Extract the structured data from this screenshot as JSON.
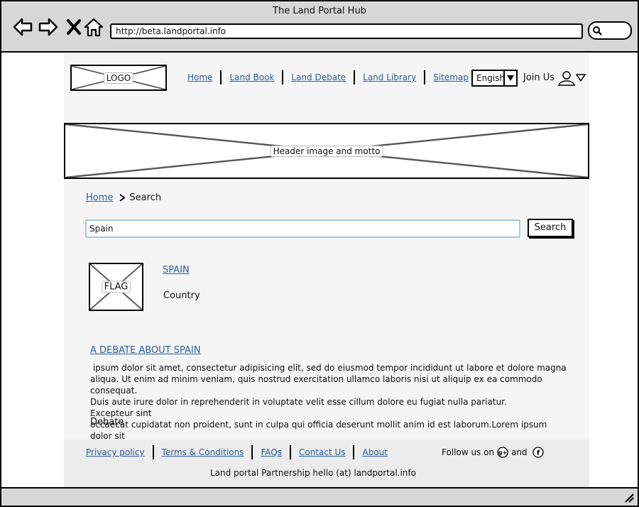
{
  "browser": {
    "title": "The Land Portal Hub",
    "url": "http://beta.landportal.info"
  },
  "header": {
    "logo_label": "LOGO",
    "menu": [
      "Home",
      "Land Book",
      "Land Debate",
      "Land Library",
      "Sitemap"
    ],
    "language": "Engish",
    "join_us": "Join Us"
  },
  "banner": {
    "label": "Header image and motto"
  },
  "breadcrumb": {
    "home": "Home",
    "current": "Search"
  },
  "search": {
    "value": "Spain",
    "button_label": "Search"
  },
  "results": [
    {
      "thumb_label": "FLAG",
      "title": "SPAIN",
      "type": "Country"
    },
    {
      "title": "A DEBATE ABOUT SPAIN",
      "lines": [
        " ipsum dolor sit amet, consectetur adipisicing elit, sed do eiusmod tempor incididunt ut labore et dolore magna",
        "aliqua. Ut enim ad minim veniam, quis nostrud exercitation ullamco laboris nisi ut aliquip ex ea commodo consequat.",
        "Duis aute irure dolor in reprehenderit in voluptate velit esse cillum dolore eu fugiat nulla pariatur. Excepteur sint",
        "occaecat cupidatat non proident, sunt in culpa qui officia deserunt mollit anim id est laborum.Lorem ipsum dolor sit"
      ],
      "type": "Debate"
    }
  ],
  "footer": {
    "links": [
      "Privacy policy",
      "Terms & Conditions",
      "FAQs",
      "Contact Us",
      "About"
    ],
    "follow_text": "Follow us on",
    "and_text": "and",
    "partnership": "Land portal Partnership hello (at) landportal.info"
  },
  "icons": [
    "back-arrow-icon",
    "forward-arrow-icon",
    "close-icon",
    "home-icon",
    "search-icon",
    "user-icon",
    "chevron-down-icon",
    "google-plus-icon",
    "facebook-icon",
    "resize-grip-icon"
  ]
}
